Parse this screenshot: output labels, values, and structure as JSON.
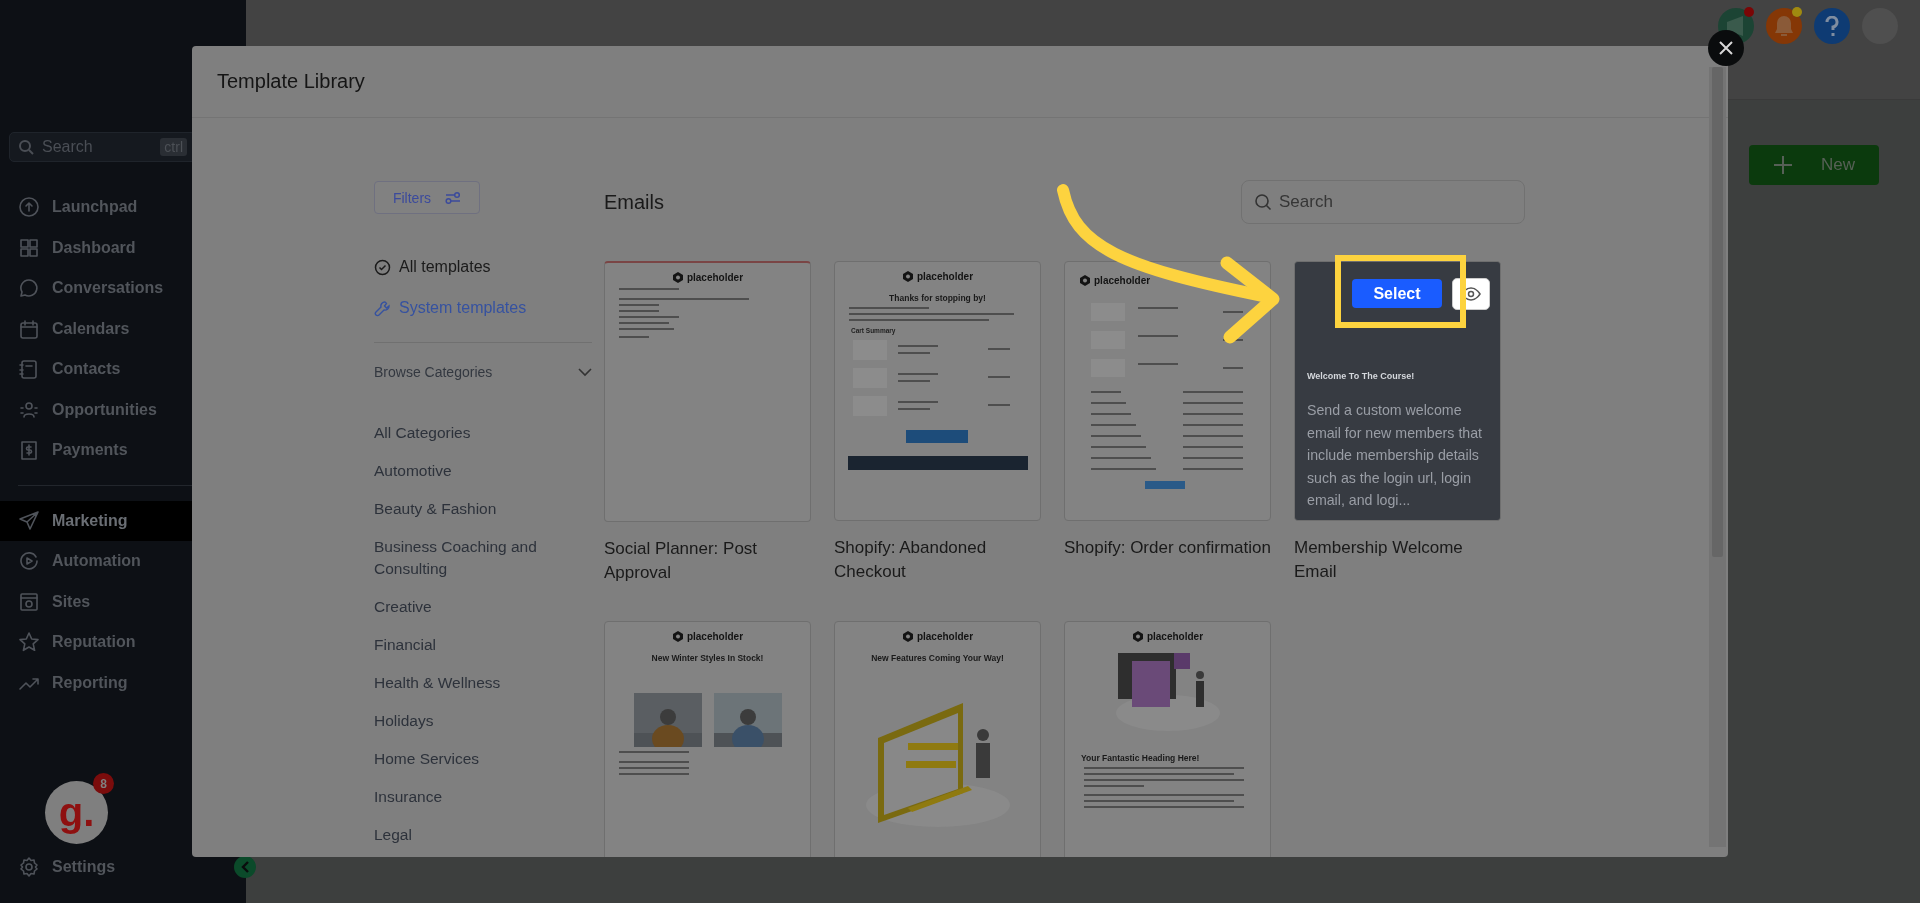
{
  "sidebar": {
    "search": {
      "placeholder": "Search",
      "shortcut": "ctrl"
    },
    "items": [
      {
        "label": "Launchpad",
        "selected": false
      },
      {
        "label": "Dashboard",
        "selected": false
      },
      {
        "label": "Conversations",
        "selected": false
      },
      {
        "label": "Calendars",
        "selected": false
      },
      {
        "label": "Contacts",
        "selected": false
      },
      {
        "label": "Opportunities",
        "selected": false
      },
      {
        "label": "Payments",
        "selected": false
      },
      {
        "label": "Marketing",
        "selected": true
      },
      {
        "label": "Automation",
        "selected": false
      },
      {
        "label": "Sites",
        "selected": false
      },
      {
        "label": "Reputation",
        "selected": false
      },
      {
        "label": "Reporting",
        "selected": false
      }
    ],
    "avatar": {
      "letter": "g.",
      "badge": "8"
    },
    "settings": "Settings"
  },
  "new_button": "New",
  "modal": {
    "title": "Template Library",
    "filters": "Filters",
    "views": [
      {
        "label": "All templates",
        "selected": true
      },
      {
        "label": "System templates",
        "selected": false
      }
    ],
    "browse": {
      "label": "Browse Categories",
      "expanded": true
    },
    "categories": [
      "All Categories",
      "Automotive",
      "Beauty & Fashion",
      "Business Coaching and Consulting",
      "Creative",
      "Financial",
      "Health & Wellness",
      "Holidays",
      "Home Services",
      "Insurance",
      "Legal"
    ],
    "section_title": "Emails",
    "search": {
      "placeholder": "Search"
    },
    "templates": [
      {
        "title": "Social Planner: Post Approval",
        "hovered": false,
        "preview": {
          "kind": "letter",
          "brand": "placeholder"
        }
      },
      {
        "title": "Shopify: Abandoned Checkout",
        "hovered": false,
        "preview": {
          "kind": "cart",
          "brand": "placeholder",
          "heading": "Thanks for stopping by!",
          "subheading": "Cart Summary"
        }
      },
      {
        "title": "Shopify: Order confirmation",
        "hovered": false,
        "preview": {
          "kind": "order",
          "brand": "placeholder"
        }
      },
      {
        "title": "Membership Welcome Email",
        "hovered": true,
        "description": "Send a custom welcome email for new members that include membership details such as the login url, login email, and logi...",
        "preview": {
          "kind": "course",
          "heading": "Welcome To The Course!"
        }
      },
      {
        "hovered": false,
        "preview": {
          "kind": "products",
          "brand": "placeholder",
          "heading": "New Winter Styles In Stock!"
        }
      },
      {
        "hovered": false,
        "preview": {
          "kind": "illustration",
          "brand": "placeholder",
          "heading": "New Features Coming Your Way!"
        }
      },
      {
        "hovered": false,
        "preview": {
          "kind": "article",
          "brand": "placeholder",
          "heading": "Your Fantastic Heading Here!"
        }
      }
    ],
    "select_button": "Select"
  }
}
